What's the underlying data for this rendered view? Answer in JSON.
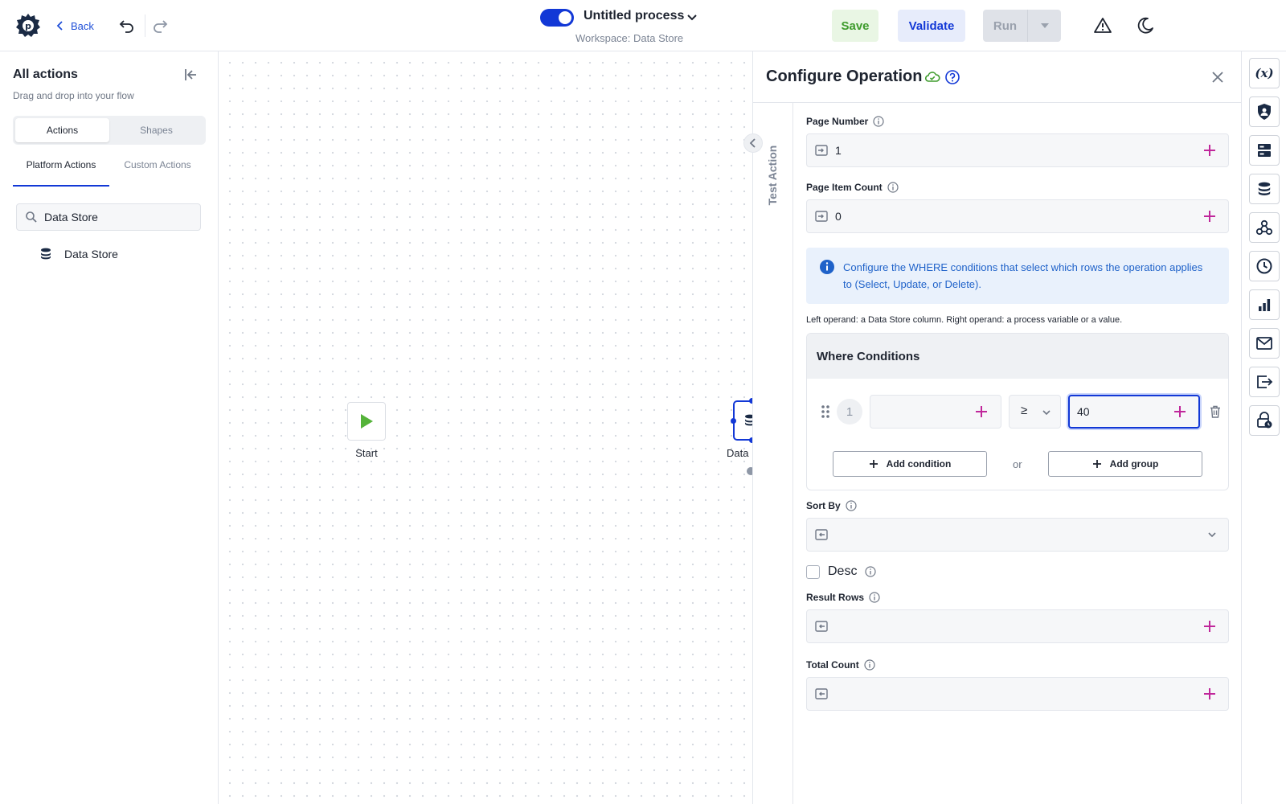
{
  "topbar": {
    "back_label": "Back",
    "process_title": "Untitled process",
    "workspace": "Workspace: Data Store",
    "save_label": "Save",
    "validate_label": "Validate",
    "run_label": "Run",
    "toggle_on": true,
    "icons": [
      "logo-gear-icon",
      "chevron-left-icon",
      "undo-icon",
      "redo-icon",
      "chevron-down-icon",
      "warning-icon",
      "moon-icon"
    ]
  },
  "sidebar": {
    "title": "All actions",
    "subtitle": "Drag and drop into your flow",
    "segments": [
      "Actions",
      "Shapes"
    ],
    "active_segment": "Actions",
    "tabs": [
      "Platform Actions",
      "Custom Actions"
    ],
    "active_tab": "Platform Actions",
    "search_value": "Data Store",
    "results": [
      {
        "label": "Data Store",
        "icon": "database-icon"
      }
    ]
  },
  "canvas": {
    "nodes": [
      {
        "label": "Start",
        "icon": "play-icon"
      },
      {
        "label": "Data",
        "icon": "database-icon"
      }
    ]
  },
  "config": {
    "title": "Configure Operation",
    "test_action_label": "Test Action",
    "page_number": {
      "label": "Page Number",
      "value": "1"
    },
    "page_item_count": {
      "label": "Page Item Count",
      "value": "0"
    },
    "info_text": "Configure the WHERE conditions that select which rows the operation applies to (Select, Update, or Delete).",
    "hint": "Left operand: a Data Store column. Right operand: a process variable or a value.",
    "where": {
      "title": "Where Conditions",
      "conditions": [
        {
          "index": "1",
          "left": "",
          "operator": "≥",
          "right": "40"
        }
      ],
      "add_condition_label": "Add condition",
      "or_label": "or",
      "add_group_label": "Add group"
    },
    "sort_by": {
      "label": "Sort By",
      "value": ""
    },
    "desc": {
      "label": "Desc",
      "checked": false
    },
    "result_rows": {
      "label": "Result Rows",
      "value": ""
    },
    "total_count": {
      "label": "Total Count",
      "value": ""
    }
  },
  "rail": {
    "icons": [
      "variable-x-icon",
      "shield-user-icon",
      "server-icon",
      "database-icon",
      "webhook-icon",
      "clock-icon",
      "bar-chart-icon",
      "mail-icon",
      "export-icon",
      "lock-clock-icon"
    ]
  },
  "colors": {
    "accent": "#1238d6",
    "success": "#3e9b2c",
    "plus": "#c0279b",
    "info": "#1f62c9"
  }
}
